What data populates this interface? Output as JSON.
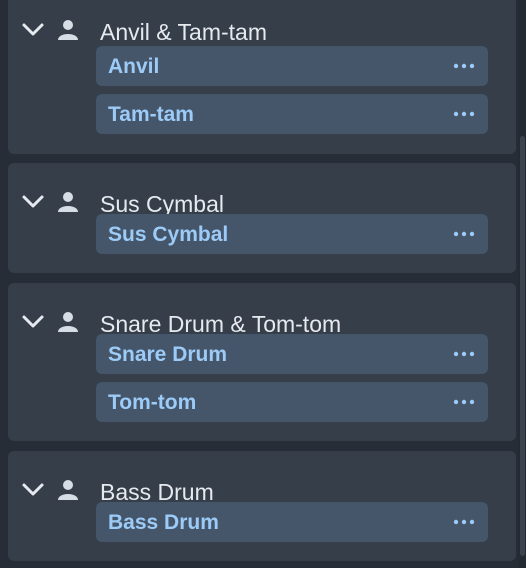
{
  "players": [
    {
      "name": "Anvil & Tam-tam",
      "chevron_icon": "chevron-down-icon",
      "person_icon": "person-icon",
      "instruments": [
        {
          "label": "Anvil",
          "more_icon": "more-horizontal-icon"
        },
        {
          "label": "Tam-tam",
          "more_icon": "more-horizontal-icon"
        }
      ]
    },
    {
      "name": "Sus Cymbal",
      "chevron_icon": "chevron-down-icon",
      "person_icon": "person-icon",
      "instruments": [
        {
          "label": "Sus Cymbal",
          "more_icon": "more-horizontal-icon"
        }
      ]
    },
    {
      "name": "Snare Drum & Tom-tom",
      "chevron_icon": "chevron-down-icon",
      "person_icon": "person-icon",
      "instruments": [
        {
          "label": "Snare Drum",
          "more_icon": "more-horizontal-icon"
        },
        {
          "label": "Tom-tom",
          "more_icon": "more-horizontal-icon"
        }
      ]
    },
    {
      "name": "Bass Drum",
      "chevron_icon": "chevron-down-icon",
      "person_icon": "person-icon",
      "instruments": [
        {
          "label": "Bass Drum",
          "more_icon": "more-horizontal-icon"
        }
      ]
    }
  ],
  "colors": {
    "background": "#262d36",
    "player_card": "#353e49",
    "instrument_card": "#46566a",
    "instrument_text": "#9ccbf7",
    "player_text": "#e6eaef"
  }
}
